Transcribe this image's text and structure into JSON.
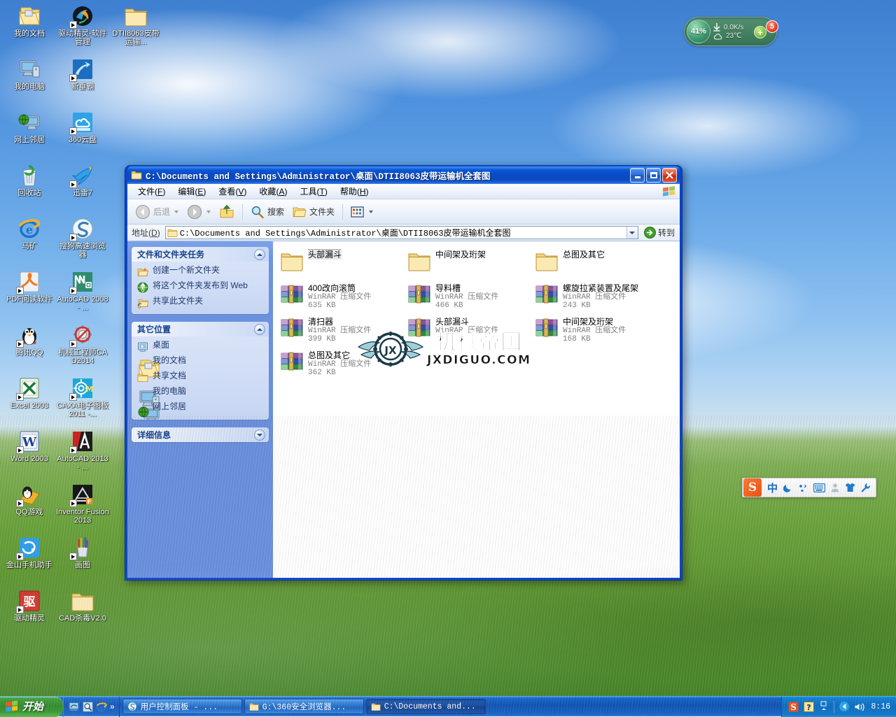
{
  "desktop": {
    "icons": [
      {
        "label": "我的文档",
        "icon": "my-documents-icon",
        "shortcut": false
      },
      {
        "label": "我的电脑",
        "icon": "my-computer-icon",
        "shortcut": false
      },
      {
        "label": "网上邻居",
        "icon": "network-places-icon",
        "shortcut": false
      },
      {
        "label": "回收站",
        "icon": "recycle-bin-icon",
        "shortcut": false
      },
      {
        "label": "马矿",
        "icon": "internet-explorer-icon",
        "shortcut": false
      },
      {
        "label": "PDF阅读软件",
        "icon": "pdf-reader-icon",
        "shortcut": true
      },
      {
        "label": "腾讯QQ",
        "icon": "qq-penguin-icon",
        "shortcut": true
      },
      {
        "label": "Excel 2003",
        "icon": "excel-icon",
        "shortcut": true
      },
      {
        "label": "Word 2003",
        "icon": "word-icon",
        "shortcut": true
      },
      {
        "label": "QQ游戏",
        "icon": "qq-games-icon",
        "shortcut": true
      },
      {
        "label": "金山手机助手",
        "icon": "kingsoft-mobile-icon",
        "shortcut": true
      },
      {
        "label": "驱动精灵",
        "icon": "driver-genius-icon",
        "shortcut": true
      },
      {
        "label": "驱动精灵-软件管理",
        "icon": "driver-genius-software-icon",
        "shortcut": true
      },
      {
        "label": "新垂霸",
        "icon": "xinchuiba-icon",
        "shortcut": true
      },
      {
        "label": "360云盘",
        "icon": "360-yunpan-icon",
        "shortcut": true
      },
      {
        "label": "迅雷7",
        "icon": "thunder-icon",
        "shortcut": true
      },
      {
        "label": "搜狗高速浏览器",
        "icon": "sogou-browser-icon",
        "shortcut": true
      },
      {
        "label": "AutoCAD 2008 - ...",
        "icon": "autocad-2008-icon",
        "shortcut": true
      },
      {
        "label": "机械工程师CAD2014",
        "icon": "mech-engineer-cad-icon",
        "shortcut": true
      },
      {
        "label": "CAXA电子图板2011 -...",
        "icon": "caxa-icon",
        "shortcut": true
      },
      {
        "label": "AutoCAD 2013 - ...",
        "icon": "autocad-2013-icon",
        "shortcut": true
      },
      {
        "label": "Inventor Fusion 2013",
        "icon": "inventor-fusion-icon",
        "shortcut": true
      },
      {
        "label": "画图",
        "icon": "paint-icon",
        "shortcut": true
      },
      {
        "label": "CAD杀毒V2.0",
        "icon": "folder-icon",
        "shortcut": false
      },
      {
        "label": "DTII8063皮带运输...",
        "icon": "folder-icon",
        "shortcut": false
      }
    ]
  },
  "netmon": {
    "cpu_percent": "41%",
    "speed": "0.0K/s",
    "temperature": "23℃",
    "badge_count": "5",
    "plus_label": "+"
  },
  "ime": {
    "logo_letter": "S",
    "mode_label": "中",
    "buttons": [
      "moon-icon",
      "punctuation-icon",
      "keyboard-icon",
      "user-icon",
      "skin-icon",
      "wrench-icon"
    ]
  },
  "explorer": {
    "title": "C:\\Documents and Settings\\Administrator\\桌面\\DTII8063皮带运输机全套图",
    "window_buttons": {
      "minimize": "_",
      "maximize": "□",
      "close": "✕"
    },
    "menu": [
      {
        "label": "文件",
        "accel": "F"
      },
      {
        "label": "编辑",
        "accel": "E"
      },
      {
        "label": "查看",
        "accel": "V"
      },
      {
        "label": "收藏",
        "accel": "A"
      },
      {
        "label": "工具",
        "accel": "T"
      },
      {
        "label": "帮助",
        "accel": "H"
      }
    ],
    "toolbar": {
      "back": "后退",
      "forward": "",
      "up": "",
      "search": "搜索",
      "folders": "文件夹",
      "views": ""
    },
    "address": {
      "label": "地址",
      "accel": "D",
      "value": "C:\\Documents and Settings\\Administrator\\桌面\\DTII8063皮带运输机全套图",
      "go_label": "转到"
    },
    "taskpane": [
      {
        "title": "文件和文件夹任务",
        "collapsed": false,
        "chevron": "up",
        "items": [
          {
            "label": "创建一个新文件夹",
            "icon": "new-folder-icon"
          },
          {
            "label": "将这个文件夹发布到 Web",
            "icon": "publish-web-icon"
          },
          {
            "label": "共享此文件夹",
            "icon": "share-folder-icon"
          }
        ]
      },
      {
        "title": "其它位置",
        "collapsed": false,
        "chevron": "up",
        "items": [
          {
            "label": "桌面",
            "icon": "desktop-icon"
          },
          {
            "label": "我的文档",
            "icon": "my-documents-icon"
          },
          {
            "label": "共享文档",
            "icon": "shared-documents-icon"
          },
          {
            "label": "我的电脑",
            "icon": "my-computer-icon"
          },
          {
            "label": "网上邻居",
            "icon": "network-places-icon"
          }
        ]
      },
      {
        "title": "详细信息",
        "collapsed": true,
        "chevron": "down",
        "items": []
      }
    ],
    "files": [
      {
        "name": "头部漏斗",
        "kind": "folder",
        "type": "",
        "size": "",
        "selected": true
      },
      {
        "name": "中间架及珩架",
        "kind": "folder",
        "type": "",
        "size": "",
        "selected": false
      },
      {
        "name": "总图及其它",
        "kind": "folder",
        "type": "",
        "size": "",
        "selected": false
      },
      {
        "name": "400改向滚筒",
        "kind": "rar",
        "type": "WinRAR 压缩文件",
        "size": "635 KB",
        "selected": false
      },
      {
        "name": "导料槽",
        "kind": "rar",
        "type": "WinRAR 压缩文件",
        "size": "466 KB",
        "selected": false
      },
      {
        "name": "螺旋拉紧装置及尾架",
        "kind": "rar",
        "type": "WinRAR 压缩文件",
        "size": "243 KB",
        "selected": false
      },
      {
        "name": "清扫器",
        "kind": "rar",
        "type": "WinRAR 压缩文件",
        "size": "399 KB",
        "selected": false
      },
      {
        "name": "头部漏斗",
        "kind": "rar",
        "type": "WinRAR 压缩文件",
        "size": "",
        "selected": false
      },
      {
        "name": "中间架及珩架",
        "kind": "rar",
        "type": "WinRAR 压缩文件",
        "size": "168 KB",
        "selected": false
      },
      {
        "name": "总图及其它",
        "kind": "rar",
        "type": "WinRAR 压缩文件",
        "size": "362 KB",
        "selected": false
      }
    ],
    "watermark": {
      "cn": "机械帝国",
      "en": "JXDIGUO.COM"
    }
  },
  "taskbar": {
    "start_label": "开始",
    "quicklaunch": [
      "show-desktop-icon",
      "search-icon",
      "internet-explorer-icon"
    ],
    "quicklaunch_more": "»",
    "tasks": [
      {
        "label": "用户控制面板 - ...",
        "icon": "sogou-browser-icon",
        "active": false
      },
      {
        "label": "G:\\360安全浏览器...",
        "icon": "folder-icon",
        "active": false
      },
      {
        "label": "C:\\Documents and...",
        "icon": "folder-icon",
        "active": true
      }
    ],
    "tray": [
      "sogou-icon",
      "help-icon",
      "network-icon",
      "volume-icon"
    ],
    "clock": "8:16"
  }
}
